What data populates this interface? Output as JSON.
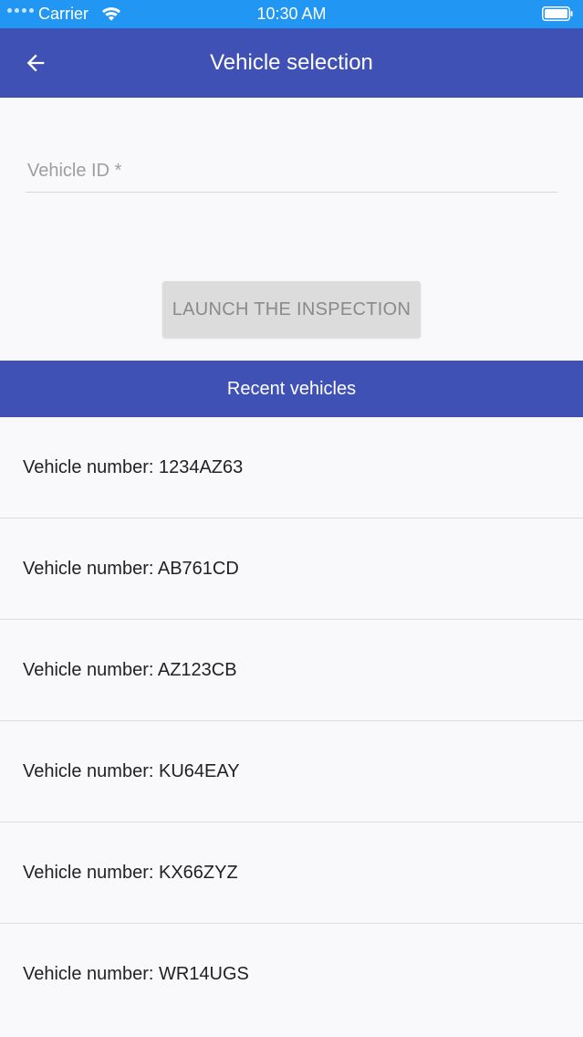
{
  "status_bar": {
    "carrier": "Carrier",
    "time": "10:30 AM",
    "wifi_icon": "wifi-icon",
    "battery_icon": "battery-icon"
  },
  "app_bar": {
    "title": "Vehicle selection",
    "back_icon": "arrow-left-icon",
    "color": "#3f51b5"
  },
  "form": {
    "vehicle_id_placeholder": "Vehicle ID *",
    "vehicle_id_value": "",
    "launch_label": "LAUNCH THE INSPECTION"
  },
  "recent": {
    "header": "Recent vehicles",
    "items": [
      {
        "label": "Vehicle number: 1234AZ63"
      },
      {
        "label": "Vehicle number: AB761CD"
      },
      {
        "label": "Vehicle number: AZ123CB"
      },
      {
        "label": "Vehicle number: KU64EAY"
      },
      {
        "label": "Vehicle number: KX66ZYZ"
      },
      {
        "label": "Vehicle number: WR14UGS"
      }
    ]
  },
  "colors": {
    "status_bar": "#2196f3",
    "primary": "#3f51b5",
    "button_disabled": "#dcdcdc",
    "background": "#f9f9fb"
  }
}
